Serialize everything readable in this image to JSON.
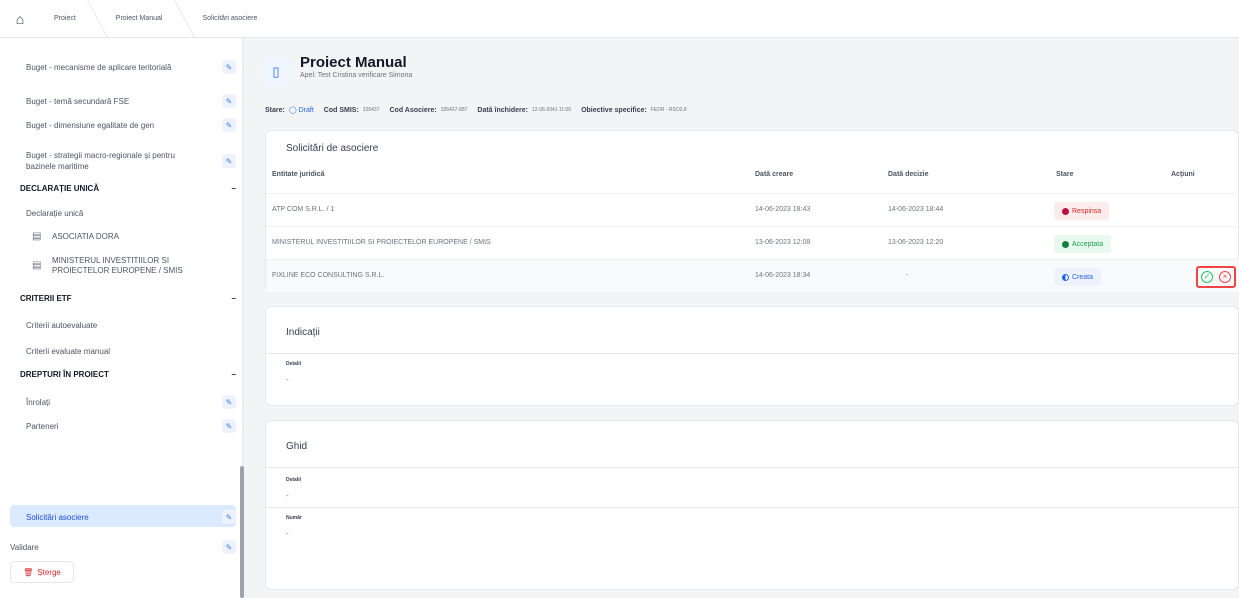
{
  "breadcrumb": [
    "Proiect",
    "Proiect Manual",
    "Solicitări asociere"
  ],
  "sidebar": {
    "items_top": [
      {
        "label": "Buget - mecanisme de aplicare teritorială"
      },
      {
        "label": "Buget - temă secundară FSE"
      },
      {
        "label": "Buget - dimensiune egalitate de gen"
      },
      {
        "label": "Buget - strategii macro-regionale și pentru bazinele maritime"
      }
    ],
    "section_declaratie": "DECLARAȚIE UNICĂ",
    "declaratie_item": "Declarație unică",
    "doc_items": [
      "ASOCIATIA DORA",
      "MINISTERUL INVESTITIILOR SI PROIECTELOR EUROPENE / SMIS"
    ],
    "section_criterii": "CRITERII ETF",
    "criterii_items": [
      "Criterii autoevaluate",
      "Criterii evaluate manual"
    ],
    "section_drepturi": "DREPTURI ÎN PROIECT",
    "drepturi_items": [
      {
        "label": "Înrolați"
      },
      {
        "label": "Parteneri"
      },
      {
        "label": "Solicitări asociere",
        "active": true
      }
    ],
    "validare": "Validare",
    "delete_label": "Șterge",
    "collapse_symbol": "–"
  },
  "project": {
    "title": "Proiect Manual",
    "subtitle": "Apel: Test Cristina verificare Simona",
    "meta": {
      "stare_label": "Stare:",
      "stare_value": "Draft",
      "cod_smis_label": "Cod SMIS:",
      "cod_smis_value": "326437",
      "cod_asociere_label": "Cod Asociere:",
      "cod_asociere_value": "326437-887",
      "data_inchidere_label": "Dată închidere:",
      "data_inchidere_value": "12-06-2041 11:00",
      "obiective_label": "Obiective specifice:",
      "obiective_value": "FEDR - RSO2.8"
    }
  },
  "solicitari": {
    "title": "Solicitări de asociere",
    "columns": [
      "Entitate juridică",
      "Dată creare",
      "Dată decizie",
      "Stare",
      "Acțiuni"
    ],
    "rows": [
      {
        "entitate": "ATP COM S.R.L. / 1",
        "creare": "14-06-2023 18:43",
        "decizie": "14-06-2023 18:44",
        "stare": "Respinsa",
        "status_type": "red"
      },
      {
        "entitate": "MINISTERUL INVESTITIILOR SI PROIECTELOR EUROPENE / SMIS",
        "creare": "13-06-2023 12:08",
        "decizie": "13-06-2023 12:20",
        "stare": "Acceptata",
        "status_type": "green"
      },
      {
        "entitate": "FIXLINE ECO CONSULTING S.R.L.",
        "creare": "14-06-2023 18:34",
        "decizie": "-",
        "stare": "Creata",
        "status_type": "blue"
      }
    ],
    "action_accept_icon": "✓",
    "action_reject_icon": "×"
  },
  "indicatii": {
    "title": "Indicații",
    "detalii_label": "Detalii",
    "detalii_value": "-"
  },
  "ghid": {
    "title": "Ghid",
    "detalii_label": "Detalii",
    "detalii_value": "-",
    "numar_label": "Număr",
    "numar_value": "-"
  }
}
